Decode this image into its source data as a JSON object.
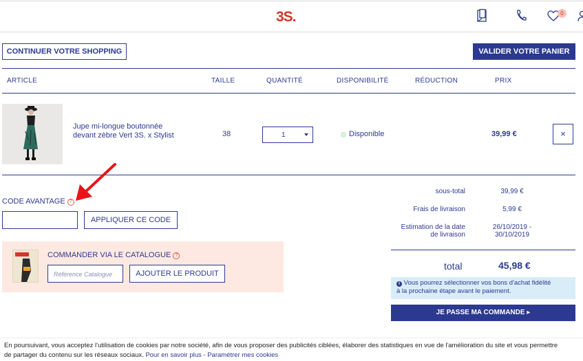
{
  "header": {
    "logo": "3S.",
    "wishlist_count": "0",
    "icons": [
      "catalog-book-icon",
      "phone-icon",
      "heart-icon",
      "user-icon"
    ]
  },
  "actions": {
    "continue_shopping": "CONTINUER VOTRE SHOPPING",
    "validate_cart": "VALIDER VOTRE PANIER"
  },
  "table": {
    "headers": {
      "article": "ARTICLE",
      "size": "TAILLE",
      "quantity": "QUANTITÉ",
      "availability": "DISPONIBILITÉ",
      "discount": "RÉDUCTION",
      "price": "PRIX"
    },
    "rows": [
      {
        "name_line1": "Jupe mi-longue boutonnée",
        "name_line2": "devant zèbre Vert 3S. x Stylist",
        "size": "38",
        "quantity": "1",
        "availability": "Disponible",
        "price": "39,99 €",
        "remove": "×"
      }
    ]
  },
  "promo": {
    "label": "CODE AVANTAGE",
    "help": "?",
    "input_value": "",
    "apply": "APPLIQUER CE CODE"
  },
  "catalog": {
    "title": "COMMANDER VIA LE CATALOGUE",
    "help": "?",
    "placeholder": "Référence Catalogue",
    "add": "AJOUTER LE PRODUIT"
  },
  "summary": {
    "subtotal_label": "sous-total",
    "subtotal": "39,99 €",
    "shipping_label": "Frais de livraison",
    "shipping": "5,99 €",
    "delivery_label_1": "Estimation de la date",
    "delivery_label_2": "de livraison",
    "delivery": "26/10/2019 - 30/10/2019",
    "total_label": "total",
    "total": "45,98 €",
    "info_line1": "Vous pourrez sélectionner vos bons d'achat fidélité",
    "info_line2": "à la prochaine étape avant le paiement.",
    "checkout": "JE PASSE MA COMMANDE ▸"
  },
  "cookie": {
    "text_line1": "En poursuivant, vous acceptez l'utilisation de cookies par notre société, afin de vous proposer des publicités ciblées, élaborer des statistiques en vue de l'amélioration du site et vous permettre",
    "text_line2": "de partager du contenu sur les réseaux sociaux. ",
    "learn_more": "Pour en savoir plus",
    "separator": " - ",
    "settings": "Paramétrer mes cookies"
  },
  "colors": {
    "navy": "#2b3990",
    "brand_red": "#d6332b",
    "arrow_red": "#e8141a",
    "catalog_bg": "#fde9e1",
    "info_bg": "#d8edf7"
  }
}
